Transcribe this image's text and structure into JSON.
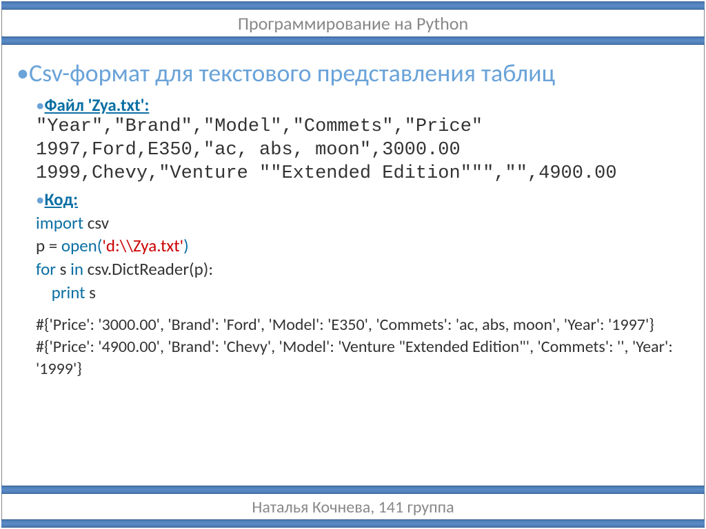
{
  "header": {
    "title": "Программирование на Python"
  },
  "footer": {
    "text": "Наталья Кочнева, 141 группа"
  },
  "main_title": "Csv-формат для текстового представления таблиц",
  "file_section": {
    "label": "Файл 'Zya.txt':",
    "line1": "\"Year\",\"Brand\",\"Model\",\"Commets\",\"Price\"",
    "line2": "1997,Ford,E350,\"ac, abs, moon\",3000.00",
    "line3": "1999,Chevy,\"Venture \"\"Extended Edition\"\"\",\"\",4900.00"
  },
  "code_section": {
    "label": "Код:",
    "l1_kw": "import",
    "l1_txt": " csv",
    "l2_p": "p = ",
    "l2_open": "open(",
    "l2_str": "'d:\\\\Zya.txt'",
    "l2_close": ")",
    "l3_for": "for",
    "l3_mid": " s ",
    "l3_in": "in",
    "l3_body": " csv.DictReader(p):",
    "l4_indent": "    ",
    "l4_print": "print",
    "l4_s": " s"
  },
  "output": {
    "line1": "#{'Price': '3000.00', 'Brand': 'Ford', 'Model': 'E350', 'Commets': 'ac, abs, moon', 'Year': '1997'}",
    "line2": "#{'Price': '4900.00', 'Brand': 'Chevy', 'Model': 'Venture \"Extended Edition\"', 'Commets': '', 'Year': '1999'}"
  }
}
